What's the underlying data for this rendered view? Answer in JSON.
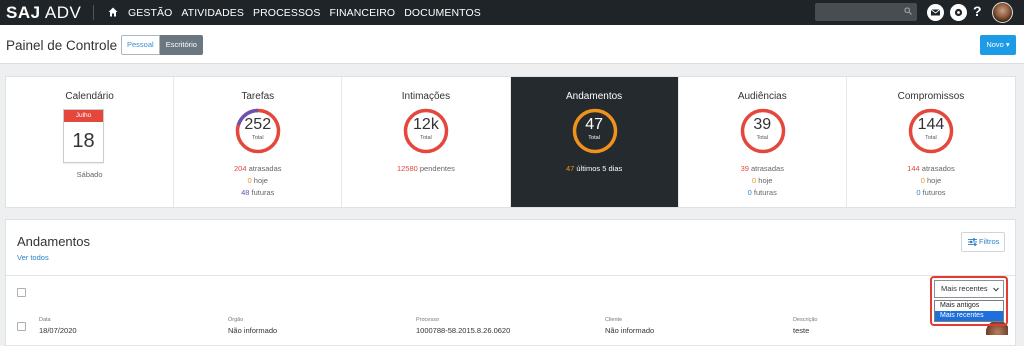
{
  "topbar": {
    "logo_bold": "SAJ",
    "logo_light": "ADV",
    "nav": [
      "GESTÃO",
      "ATIVIDADES",
      "PROCESSOS",
      "FINANCEIRO",
      "DOCUMENTOS"
    ],
    "help_label": "?"
  },
  "header": {
    "title": "Painel de Controle",
    "toggle": [
      "Pessoal",
      "Escritório"
    ],
    "toggle_selected": "Escritório",
    "new_button": "Novo ▾"
  },
  "stats": {
    "calendar": {
      "title": "Calendário",
      "month": "Julho",
      "day": "18",
      "weekday": "Sábado"
    },
    "tarefas": {
      "title": "Tarefas",
      "total": "252",
      "total_label": "Total",
      "late_num": "204",
      "late_txt": " atrasadas",
      "today_num": "0",
      "today_txt": " hoje",
      "future_num": "48",
      "future_txt": " futuras"
    },
    "intimacoes": {
      "title": "Intimações",
      "total": "12k",
      "total_label": "Total",
      "pending_num": "12580",
      "pending_txt": " pendentes"
    },
    "andamentos": {
      "title": "Andamentos",
      "total": "47",
      "total_label": "Total",
      "recent_num": "47",
      "recent_txt": " últimos 5 dias"
    },
    "audiencias": {
      "title": "Audiências",
      "total": "39",
      "total_label": "Total",
      "late_num": "39",
      "late_txt": " atrasadas",
      "today_num": "0",
      "today_txt": " hoje",
      "future_num": "0",
      "future_txt": " futuras"
    },
    "compromissos": {
      "title": "Compromissos",
      "total": "144",
      "total_label": "Total",
      "late_num": "144",
      "late_txt": " atrasados",
      "today_num": "0",
      "today_txt": " hoje",
      "future_num": "0",
      "future_txt": " futuros"
    }
  },
  "panel": {
    "title": "Andamentos",
    "see_all": "Ver todos",
    "filters": "Filtros",
    "sort": {
      "selected": "Mais recentes",
      "options": [
        "Mais antigos",
        "Mais recentes"
      ]
    },
    "columns": [
      "Data",
      "Órgão",
      "Processo",
      "Cliente",
      "Descrição"
    ],
    "row": {
      "data": "18/07/2020",
      "orgao": "Não informado",
      "processo": "1000788-58.2015.8.26.0620",
      "cliente": "Não informado",
      "descricao": "teste"
    }
  },
  "colors": {
    "topbar": "#1f2428",
    "accent": "#1e9be6",
    "red": "#e4473b",
    "orange": "#f0921b",
    "purple": "#6a52b4"
  }
}
